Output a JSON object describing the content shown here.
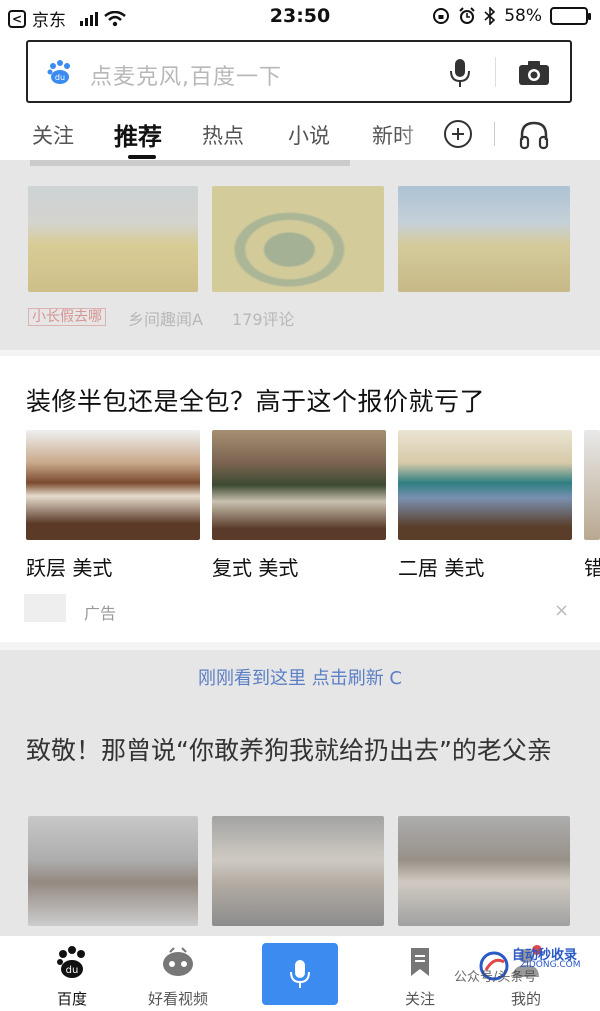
{
  "status_bar": {
    "back_app": "京东",
    "time": "23:50",
    "battery_text": "58%",
    "battery_level": 0.58
  },
  "search": {
    "placeholder": "点麦克风,百度一下"
  },
  "tabs": {
    "items": [
      "关注",
      "推荐",
      "热点",
      "小说",
      "新时"
    ],
    "active": "推荐"
  },
  "feed": {
    "top_card": {
      "source_tag": "小长假去哪",
      "source": "乡间趣闻A",
      "comments": "179评论"
    },
    "ad_card": {
      "title": "装修半包还是全包？高于这个报价就亏了",
      "captions": [
        "跃层 美式",
        "复式 美式",
        "二居 美式",
        "错"
      ],
      "ad_label": "广告",
      "close": "×"
    },
    "refresh_text": "刚刚看到这里 点击刷新 C",
    "news_card": {
      "title": "致敬！那曾说“你敢养狗我就给扔出去”的老父亲"
    }
  },
  "bottom_bar": {
    "items": [
      "百度",
      "好看视频",
      "关注",
      "我的"
    ],
    "watermark_brand": "自动秒收录",
    "watermark_site": "ZIDONG.COM",
    "watermark_text": "公众号/头条号"
  },
  "colors": {
    "accent": "#3b8bf0",
    "refresh": "#5b7fc5",
    "tag_red": "#e04848"
  }
}
